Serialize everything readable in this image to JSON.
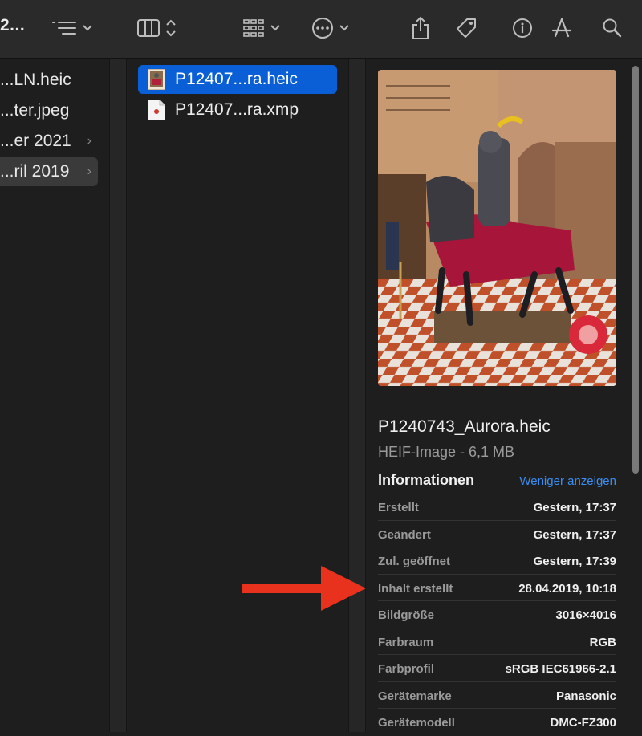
{
  "toolbar": {
    "title": "2...",
    "icons": [
      "list-view-icon",
      "chevron-down-icon",
      "column-view-icon",
      "up-down-chevron-icon",
      "group-icon",
      "more-icon",
      "share-icon",
      "tag-icon",
      "info-icon",
      "app-store-icon",
      "search-icon"
    ]
  },
  "column1": {
    "items": [
      {
        "label": "...LN.heic",
        "arrow": ""
      },
      {
        "label": "...ter.jpeg",
        "arrow": ""
      },
      {
        "label": "...er 2021",
        "arrow": "›"
      },
      {
        "label": "...ril 2019",
        "arrow": "›"
      }
    ]
  },
  "column2": {
    "items": [
      {
        "label": "P12407...ra.heic"
      },
      {
        "label": "P12407...ra.xmp"
      }
    ]
  },
  "inspector": {
    "filename": "P1240743_Aurora.heic",
    "meta": "HEIF-Image - 6,1 MB",
    "info_heading": "Informationen",
    "less_link": "Weniger anzeigen",
    "rows": [
      {
        "key": "Erstellt",
        "value": "Gestern, 17:37"
      },
      {
        "key": "Geändert",
        "value": "Gestern, 17:37"
      },
      {
        "key": "Zul. geöffnet",
        "value": "Gestern, 17:39"
      },
      {
        "key": "Inhalt erstellt",
        "value": "28.04.2019, 10:18"
      },
      {
        "key": "Bildgröße",
        "value": "3016×4016"
      },
      {
        "key": "Farbraum",
        "value": "RGB"
      },
      {
        "key": "Farbprofil",
        "value": "sRGB IEC61966-2.1"
      },
      {
        "key": "Gerätemarke",
        "value": "Panasonic"
      },
      {
        "key": "Gerätemodell",
        "value": "DMC-FZ300"
      }
    ]
  },
  "colors": {
    "selection": "#0a5fd7",
    "link": "#3b8ef3",
    "annotation_arrow": "#e8321e"
  }
}
